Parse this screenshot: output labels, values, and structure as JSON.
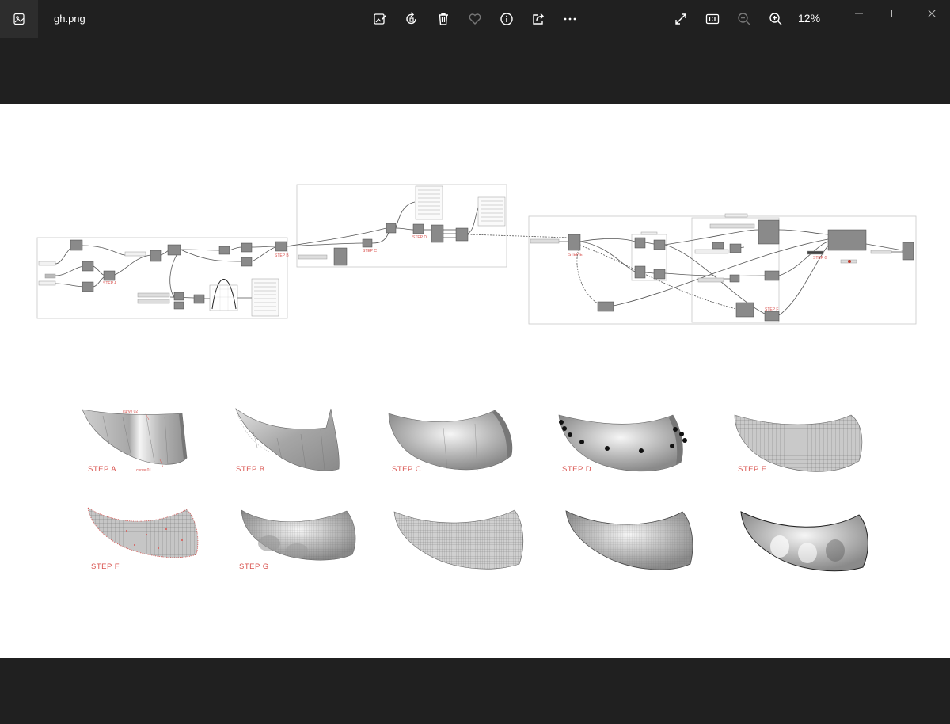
{
  "window": {
    "filename": "gh.png",
    "zoom": "12%"
  },
  "toolbar": {
    "buttons": [
      {
        "name": "edit-image-icon"
      },
      {
        "name": "rotate-icon"
      },
      {
        "name": "delete-icon"
      },
      {
        "name": "favorite-icon"
      },
      {
        "name": "info-icon"
      },
      {
        "name": "share-icon"
      },
      {
        "name": "more-icon"
      }
    ],
    "right": [
      {
        "name": "fullscreen-icon"
      },
      {
        "name": "actual-size-icon"
      },
      {
        "name": "zoom-out-icon"
      },
      {
        "name": "zoom-in-icon"
      }
    ]
  },
  "diagram": {
    "graph_labels": {
      "step_a": "STEP A",
      "step_b": "STEP B",
      "step_c": "STEP C",
      "step_d": "STEP D",
      "step_e": "STEP E",
      "step_f": "STEP F",
      "step_g": "STEP G"
    },
    "render_labels": {
      "row1": [
        "STEP A",
        "STEP B",
        "STEP C",
        "STEP D",
        "STEP E"
      ],
      "row2": [
        "STEP F",
        "STEP G"
      ],
      "curve02": "curve 02",
      "curve01": "curve 01"
    }
  },
  "colors": {
    "chrome": "#202020",
    "canvas": "#ffffff",
    "accent_red": "#d9534f"
  }
}
